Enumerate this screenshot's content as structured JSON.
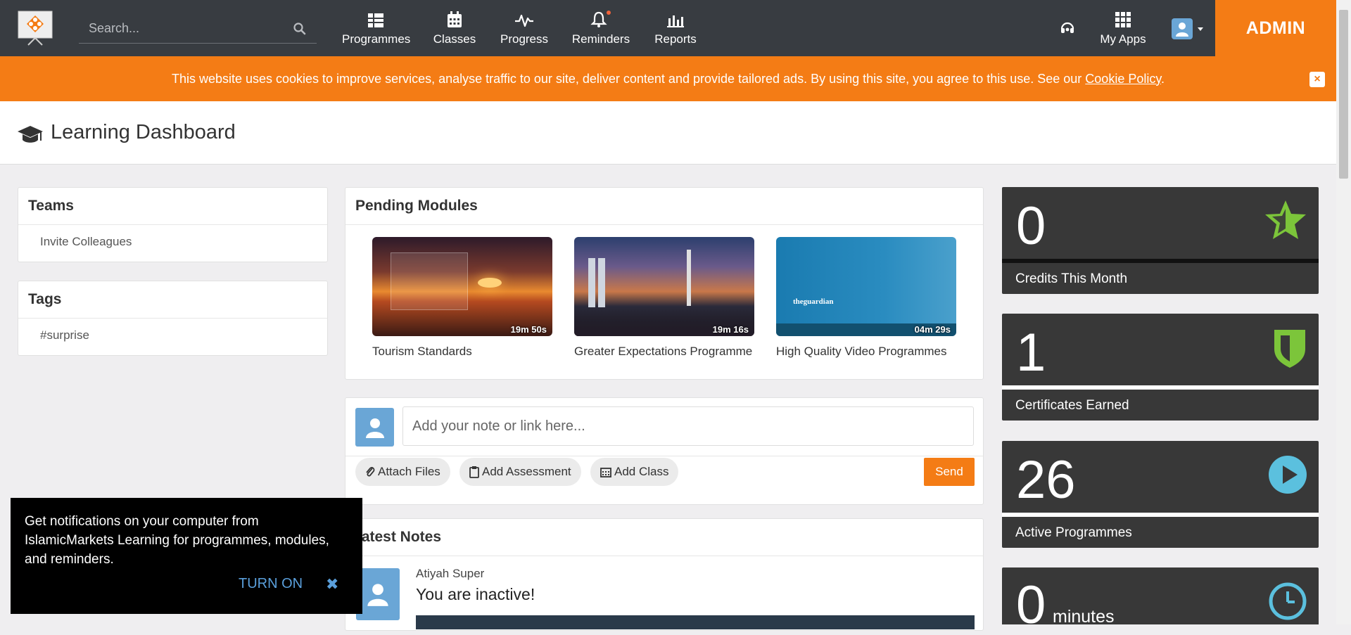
{
  "nav": {
    "search_placeholder": "Search...",
    "items": [
      {
        "label": "Programmes",
        "icon": "table-icon"
      },
      {
        "label": "Classes",
        "icon": "calendar-icon"
      },
      {
        "label": "Progress",
        "icon": "pulse-icon"
      },
      {
        "label": "Reminders",
        "icon": "bell-icon"
      },
      {
        "label": "Reports",
        "icon": "bar-chart-icon"
      }
    ],
    "my_apps": "My Apps",
    "admin": "ADMIN"
  },
  "cookie": {
    "text": "This website uses cookies to improve services, analyse traffic to our site, deliver content and provide tailored ads. By using this site, you agree to this use. See our ",
    "link": "Cookie Policy",
    "suffix": ".",
    "close": "×"
  },
  "page": {
    "title": "Learning Dashboard"
  },
  "teams": {
    "title": "Teams",
    "item": "Invite Colleagues"
  },
  "tags": {
    "title": "Tags",
    "item": "#surprise"
  },
  "pending": {
    "title": "Pending Modules",
    "modules": [
      {
        "title": "Tourism Standards",
        "duration": "19m 50s"
      },
      {
        "title": "Greater Expectations Programme",
        "duration": "19m 16s"
      },
      {
        "title": "High Quality Video Programmes",
        "duration": "04m 29s",
        "brand": "theguardian"
      }
    ]
  },
  "note": {
    "placeholder": "Add your note or link here...",
    "attach": "Attach Files",
    "assessment": "Add Assessment",
    "class": "Add Class",
    "send": "Send"
  },
  "latest": {
    "title": "Latest Notes",
    "author": "Atiyah Super",
    "text": "You are inactive!"
  },
  "stats": [
    {
      "value": "0",
      "label": "Credits This Month",
      "icon": "star-icon",
      "color": "#7cc53a"
    },
    {
      "value": "1",
      "label": "Certificates Earned",
      "icon": "shield-icon",
      "color": "#7cc53a"
    },
    {
      "value": "26",
      "label": "Active Programmes",
      "icon": "play-icon",
      "color": "#5bc0de"
    },
    {
      "value": "0",
      "unit": "minutes",
      "icon": "clock-icon",
      "color": "#5bc0de"
    }
  ],
  "notification": {
    "text": "Get notifications on your computer from IslamicMarkets Learning for programmes, modules, and reminders.",
    "turn_on": "TURN ON",
    "close": "✖"
  }
}
